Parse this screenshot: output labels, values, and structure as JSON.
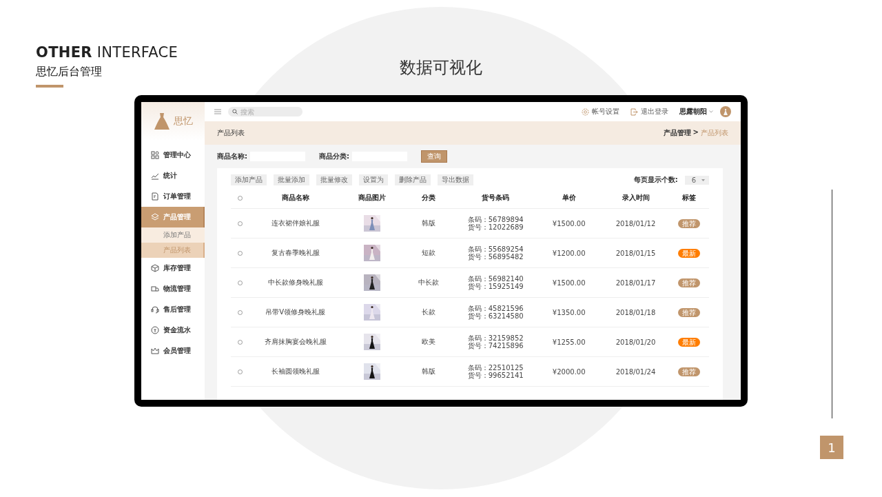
{
  "slide": {
    "heading_bold": "OTHER",
    "heading_light": "INTERFACE",
    "subtitle": "思忆后台管理",
    "title": "数据可视化",
    "page_number": "1"
  },
  "app": {
    "logo_text": "思忆",
    "sidebar": {
      "items": [
        {
          "label": "管理中心",
          "selected": false
        },
        {
          "label": "统计",
          "selected": false
        },
        {
          "label": "订单管理",
          "selected": false
        },
        {
          "label": "产品管理",
          "selected": true,
          "children": [
            {
              "label": "添加产品",
              "selected": false
            },
            {
              "label": "产品列表",
              "selected": true
            }
          ]
        },
        {
          "label": "库存管理",
          "selected": false
        },
        {
          "label": "物流管理",
          "selected": false
        },
        {
          "label": "售后管理",
          "selected": false
        },
        {
          "label": "资金流水",
          "selected": false
        },
        {
          "label": "会员管理",
          "selected": false
        }
      ]
    },
    "topbar": {
      "search": {
        "placeholder": "搜索"
      },
      "actions": [
        "帐号设置",
        "退出登录"
      ],
      "user": "思露朝阳"
    },
    "header": {
      "title": "产品列表",
      "separator": ">",
      "breadcrumb": [
        {
          "label": "产品管理",
          "current": false
        },
        {
          "label": "产品列表",
          "current": true
        }
      ]
    },
    "filters": [
      {
        "label": "商品名称:"
      },
      {
        "label": "商品分类:"
      }
    ],
    "query_button": "查询",
    "toolbar": [
      "添加产品",
      "批量添加",
      "批量修改",
      "设置为",
      "删除产品",
      "导出数据"
    ],
    "page_size": {
      "label": "每页显示个数:",
      "value": "6"
    },
    "table": {
      "header_selected": false,
      "columns": [
        "商品名称",
        "商品图片",
        "分类",
        "货号条码",
        "单价",
        "录入时间",
        "标签"
      ],
      "rows": [
        {
          "selected": false,
          "name": "连衣裙伴娘礼服",
          "category": "韩版",
          "barcode": "条码：56789894",
          "item_no": "货号：12022689",
          "price": "¥1500.00",
          "date": "2018/01/12",
          "tag": {
            "label": "推荐",
            "color": "#c0956b"
          }
        },
        {
          "selected": false,
          "name": "复古春季晚礼服",
          "category": "短款",
          "barcode": "条码：55689254",
          "item_no": "货号：56895482",
          "price": "¥1200.00",
          "date": "2018/01/15",
          "tag": {
            "label": "最新",
            "color": "#ff7d00"
          }
        },
        {
          "selected": false,
          "name": "中长款修身晚礼服",
          "category": "中长款",
          "barcode": "条码：56982140",
          "item_no": "货号：15925149",
          "price": "¥1500.00",
          "date": "2018/01/17",
          "tag": {
            "label": "推荐",
            "color": "#c0956b"
          }
        },
        {
          "selected": false,
          "name": "吊带V领修身晚礼服",
          "category": "长款",
          "barcode": "条码：45821596",
          "item_no": "货号：63214580",
          "price": "¥1350.00",
          "date": "2018/01/18",
          "tag": {
            "label": "推荐",
            "color": "#c0956b"
          }
        },
        {
          "selected": false,
          "name": "齐肩抹胸宴会晚礼服",
          "category": "欧美",
          "barcode": "条码：32159852",
          "item_no": "货号：74215896",
          "price": "¥1255.00",
          "date": "2018/01/20",
          "tag": {
            "label": "最新",
            "color": "#ff7d00"
          }
        },
        {
          "selected": false,
          "name": "长袖圆领晚礼服",
          "category": "韩版",
          "barcode": "条码：22510125",
          "item_no": "货号：99652141",
          "price": "¥2000.00",
          "date": "2018/01/24",
          "tag": {
            "label": "推荐",
            "color": "#c0956b"
          }
        }
      ]
    }
  }
}
